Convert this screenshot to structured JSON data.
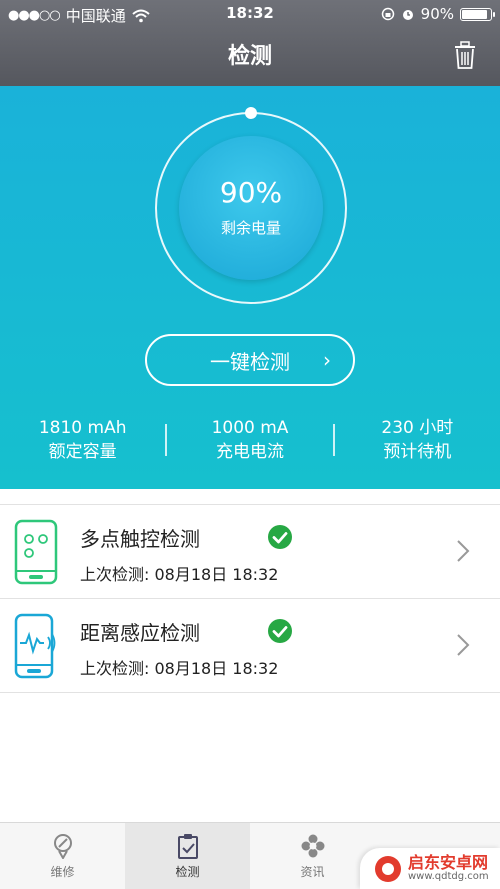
{
  "status": {
    "signal_dots": "●●●○○",
    "carrier": "中国联通",
    "time": "18:32",
    "battery_text": "90%",
    "battery_level": 0.9
  },
  "nav": {
    "title": "检测"
  },
  "hero": {
    "percent": "90%",
    "percent_label": "剩余电量",
    "detect_button": "一键检测",
    "chevron": "›",
    "stats": [
      {
        "value": "1810 mAh",
        "label": "额定容量"
      },
      {
        "value": "1000 mA",
        "label": "充电电流"
      },
      {
        "value": "230 小时",
        "label": "预计待机"
      }
    ]
  },
  "list": [
    {
      "title": "多点触控检测",
      "subtitle": "上次检测: 08月18日 18:32"
    },
    {
      "title": "距离感应检测",
      "subtitle": "上次检测: 08月18日 18:32"
    }
  ],
  "tabs": [
    {
      "label": "维修"
    },
    {
      "label": "检测"
    },
    {
      "label": "资讯"
    }
  ],
  "watermark": {
    "title": "启东安卓网",
    "url": "www.qdtdg.com"
  },
  "colors": {
    "accent": "#1ab2d9",
    "check_green": "#27a844",
    "touch_icon_green": "#2ec77a"
  }
}
